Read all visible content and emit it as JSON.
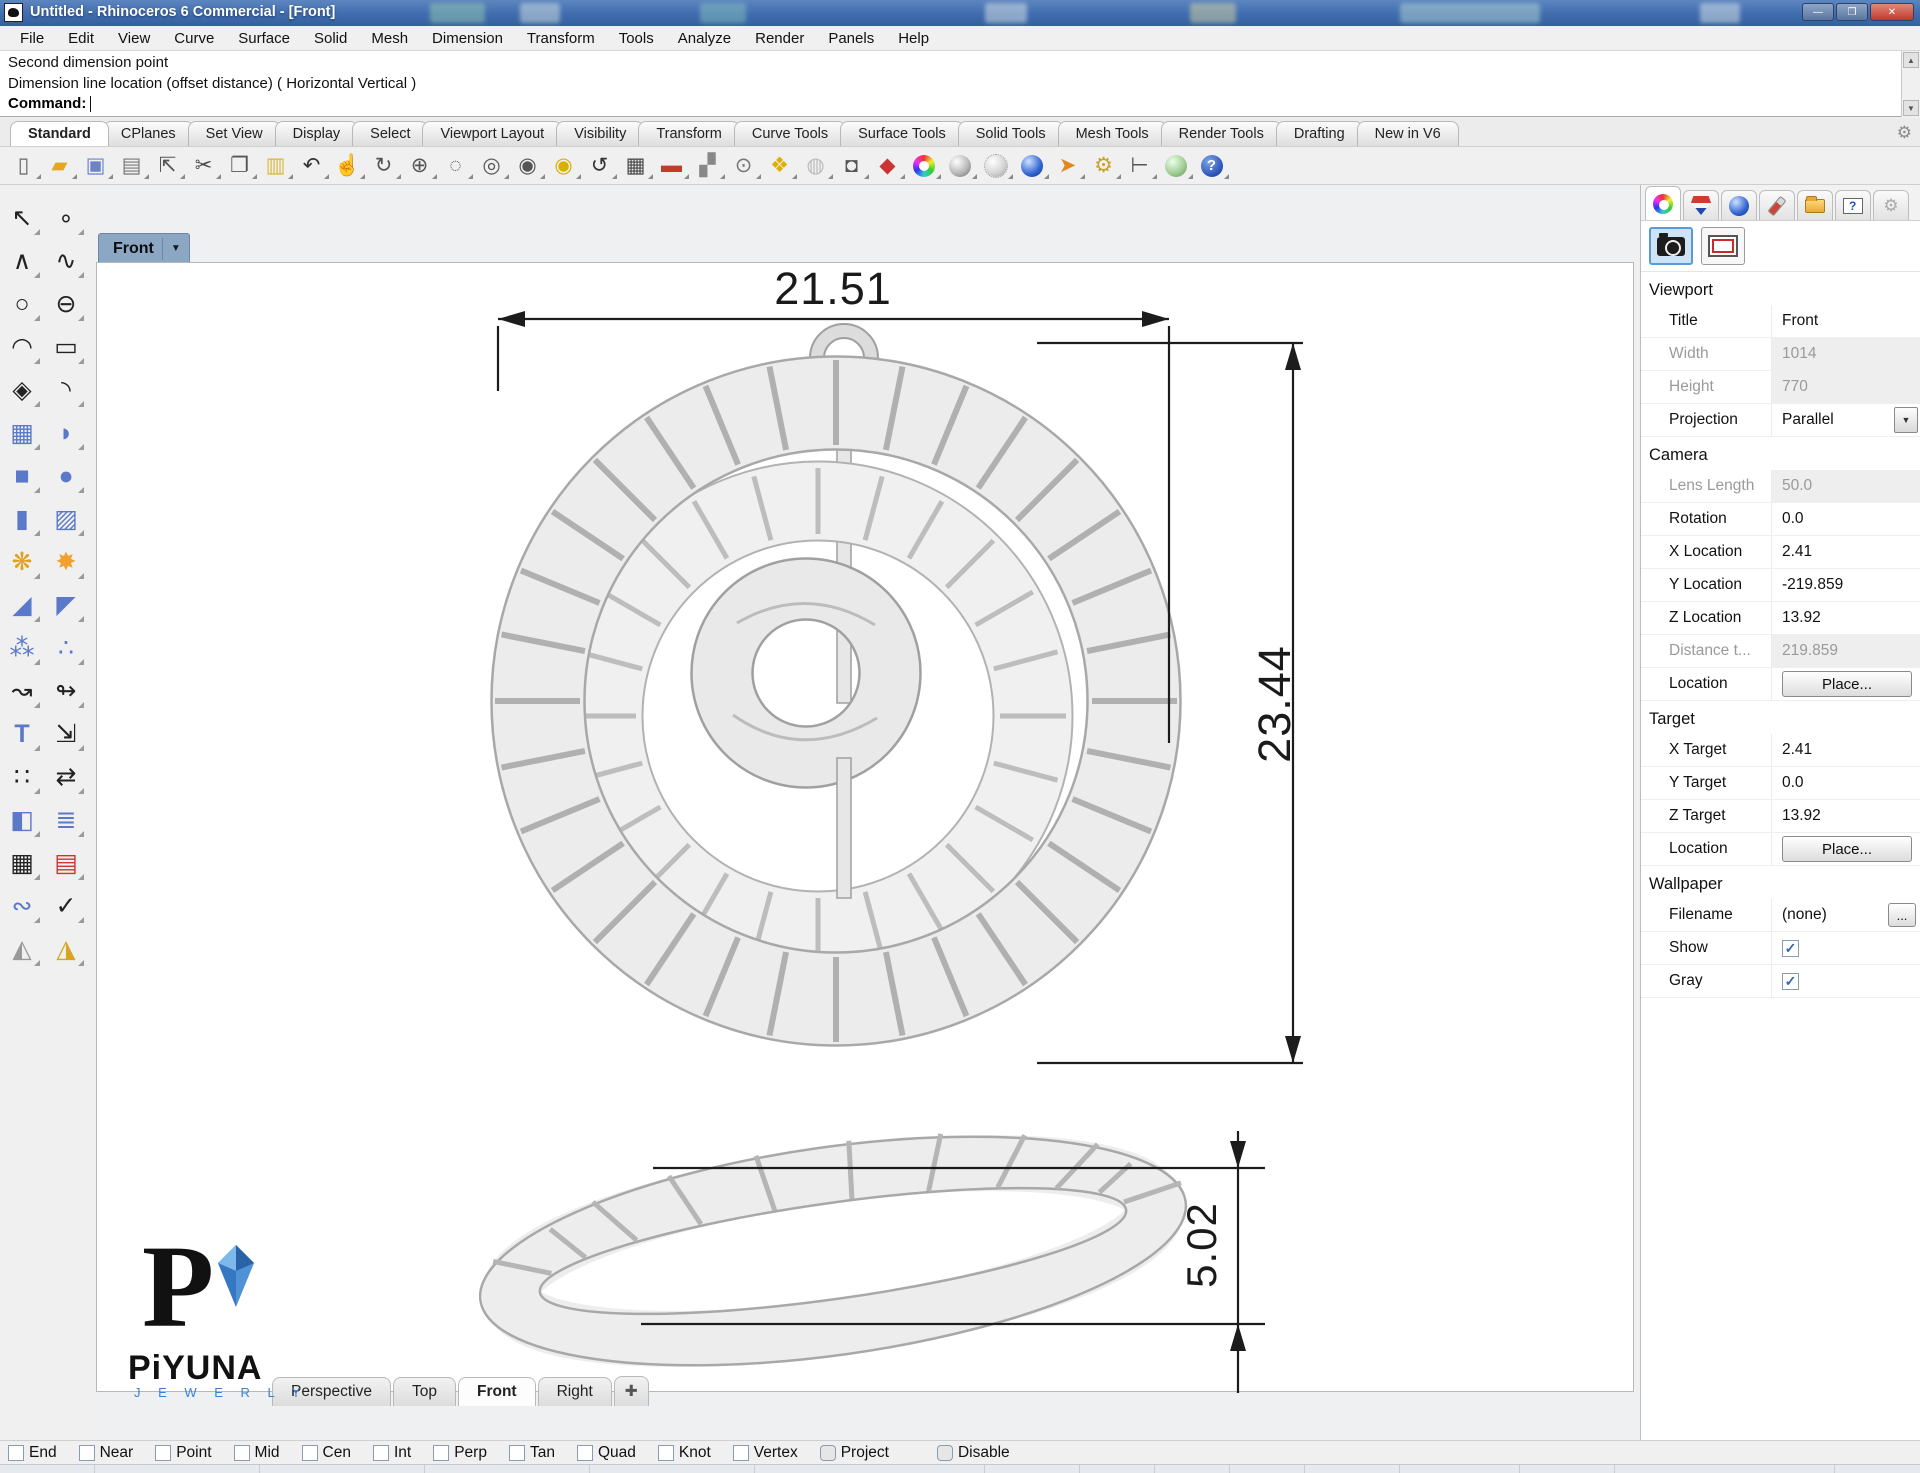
{
  "window": {
    "title": "Untitled - Rhinoceros 6 Commercial - [Front]",
    "buttons": {
      "minimize": "—",
      "restore": "❐",
      "close": "✕"
    }
  },
  "menu": {
    "items": [
      "File",
      "Edit",
      "View",
      "Curve",
      "Surface",
      "Solid",
      "Mesh",
      "Dimension",
      "Transform",
      "Tools",
      "Analyze",
      "Render",
      "Panels",
      "Help"
    ]
  },
  "command": {
    "history_line1": "Second dimension point",
    "history_line2": "Dimension line location (offset distance) ( Horizontal  Vertical )",
    "prompt_label": "Command:"
  },
  "tabstrip": {
    "tabs": [
      "Standard",
      "CPlanes",
      "Set View",
      "Display",
      "Select",
      "Viewport Layout",
      "Visibility",
      "Transform",
      "Curve Tools",
      "Surface Tools",
      "Solid Tools",
      "Mesh Tools",
      "Render Tools",
      "Drafting",
      "New in V6"
    ],
    "active": "Standard",
    "gear_glyph": "⚙"
  },
  "toolbar": {
    "icons": [
      {
        "glyph": "▯",
        "css": "color:#666"
      },
      {
        "glyph": "▰",
        "css": "color:#e3a820"
      },
      {
        "glyph": "▣",
        "css": "color:#6d83c9"
      },
      {
        "glyph": "▤",
        "css": "color:#777"
      },
      {
        "glyph": "⇱",
        "css": "color:#555"
      },
      {
        "glyph": "✂",
        "css": "color:#444"
      },
      {
        "glyph": "❐",
        "css": "color:#555"
      },
      {
        "glyph": "▥",
        "css": "color:#d9b83f"
      },
      {
        "glyph": "↶",
        "css": "color:#333"
      },
      {
        "glyph": "☝",
        "css": "color:#999"
      },
      {
        "glyph": "↻",
        "css": "color:#555"
      },
      {
        "glyph": "⊕",
        "css": "color:#555"
      },
      {
        "glyph": "◌",
        "css": "color:#555"
      },
      {
        "glyph": "◎",
        "css": "color:#555"
      },
      {
        "glyph": "◉",
        "css": "color:#555"
      },
      {
        "glyph": "◉",
        "css": "color:#d9b000"
      },
      {
        "glyph": "↺",
        "css": "color:#333"
      },
      {
        "glyph": "▦",
        "css": "color:#444"
      },
      {
        "glyph": "▬",
        "css": "color:#c23a2a"
      },
      {
        "glyph": "▞",
        "css": "color:#888"
      },
      {
        "glyph": "⊙",
        "css": "color:#777"
      },
      {
        "glyph": "❖",
        "css": "color:#dfae00"
      },
      {
        "glyph": "◍",
        "css": "color:#b9b9b9"
      },
      {
        "glyph": "◘",
        "css": "color:#555"
      },
      {
        "glyph": "◆",
        "css": "color:#cc3333"
      },
      {
        "glyph": "",
        "css": ""
      },
      {
        "glyph": "",
        "css": ""
      },
      {
        "glyph": "",
        "css": ""
      },
      {
        "glyph": "",
        "css": ""
      },
      {
        "glyph": "➤",
        "css": "color:#e2881f"
      },
      {
        "glyph": "⚙",
        "css": "color:#c9a227"
      },
      {
        "glyph": "⊢",
        "css": "color:#555"
      },
      {
        "glyph": "",
        "css": ""
      },
      {
        "glyph": "?",
        "css": ""
      }
    ]
  },
  "sidebar": {
    "icons": [
      {
        "glyph": "↖",
        "css": "color:#222"
      },
      {
        "glyph": "∘",
        "css": "color:#222"
      },
      {
        "glyph": "∧",
        "css": "color:#222"
      },
      {
        "glyph": "∿",
        "css": "color:#222"
      },
      {
        "glyph": "○",
        "css": "color:#222"
      },
      {
        "glyph": "⊖",
        "css": "color:#222"
      },
      {
        "glyph": "◠",
        "css": "color:#222"
      },
      {
        "glyph": "▭",
        "css": "color:#222"
      },
      {
        "glyph": "◈",
        "css": "color:#222"
      },
      {
        "glyph": "◝",
        "css": "color:#222"
      },
      {
        "glyph": "▦",
        "css": "color:#5b79c9"
      },
      {
        "glyph": "◗",
        "css": "color:#5b79c9"
      },
      {
        "glyph": "■",
        "css": "color:#5b79c9"
      },
      {
        "glyph": "●",
        "css": "color:#5b79c9"
      },
      {
        "glyph": "▮",
        "css": "color:#5b79c9"
      },
      {
        "glyph": "▨",
        "css": "color:#5b79c9"
      },
      {
        "glyph": "❋",
        "css": "color:#e0a020"
      },
      {
        "glyph": "✸",
        "css": "color:#f0a030"
      },
      {
        "glyph": "◢",
        "css": "color:#5b79c9"
      },
      {
        "glyph": "◤",
        "css": "color:#5b79c9"
      },
      {
        "glyph": "⁂",
        "css": "color:#5b79c9"
      },
      {
        "glyph": "∴",
        "css": "color:#5b79c9"
      },
      {
        "glyph": "↝",
        "css": "color:#222"
      },
      {
        "glyph": "↬",
        "css": "color:#222"
      },
      {
        "glyph": "T",
        "css": "color:#5b79c9;font-weight:bold"
      },
      {
        "glyph": "⇲",
        "css": "color:#222"
      },
      {
        "glyph": "∷",
        "css": "color:#222"
      },
      {
        "glyph": "⇄",
        "css": "color:#222"
      },
      {
        "glyph": "◧",
        "css": "color:#5b79c9"
      },
      {
        "glyph": "≣",
        "css": "color:#5b79c9"
      },
      {
        "glyph": "▦",
        "css": "color:#222"
      },
      {
        "glyph": "▤",
        "css": "color:#cc3333"
      },
      {
        "glyph": "∾",
        "css": "color:#5b79c9"
      },
      {
        "glyph": "✓",
        "css": "color:#222"
      },
      {
        "glyph": "◭",
        "css": "color:#999"
      },
      {
        "glyph": "◮",
        "css": "color:#d9a520"
      }
    ]
  },
  "viewport": {
    "tab_label": "Front",
    "tab_arrow": "▼",
    "dim_width": "21.51",
    "dim_height": "23.44",
    "dim_thickness": "5.02"
  },
  "logo": {
    "mark": "P",
    "brand": "PiYUNA",
    "sub": "J E W E R L Y"
  },
  "bottom_tabs": {
    "tabs": [
      "Perspective",
      "Top",
      "Front",
      "Right"
    ],
    "active": "Front",
    "add_label": "✚"
  },
  "panel": {
    "viewport": {
      "title": "Viewport",
      "rows": [
        {
          "label": "Title",
          "value": "Front"
        },
        {
          "label": "Width",
          "value": "1014"
        },
        {
          "label": "Height",
          "value": "770"
        },
        {
          "label": "Projection",
          "value": "Parallel"
        }
      ],
      "dropdown_arrow": "▼"
    },
    "camera": {
      "title": "Camera",
      "rows": [
        {
          "label": "Lens Length",
          "value": "50.0"
        },
        {
          "label": "Rotation",
          "value": "0.0"
        },
        {
          "label": "X Location",
          "value": "2.41"
        },
        {
          "label": "Y Location",
          "value": "-219.859"
        },
        {
          "label": "Z Location",
          "value": "13.92"
        },
        {
          "label": "Distance t...",
          "value": "219.859"
        },
        {
          "label": "Location",
          "value": "Place..."
        }
      ]
    },
    "target": {
      "title": "Target",
      "rows": [
        {
          "label": "X Target",
          "value": "2.41"
        },
        {
          "label": "Y Target",
          "value": "0.0"
        },
        {
          "label": "Z Target",
          "value": "13.92"
        },
        {
          "label": "Location",
          "value": "Place..."
        }
      ]
    },
    "wallpaper": {
      "title": "Wallpaper",
      "rows": [
        {
          "label": "Filename",
          "value": "(none)",
          "more": "..."
        },
        {
          "label": "Show"
        },
        {
          "label": "Gray"
        }
      ]
    }
  },
  "osnap": {
    "items": [
      "End",
      "Near",
      "Point",
      "Mid",
      "Cen",
      "Int",
      "Perp",
      "Tan",
      "Quad",
      "Knot",
      "Vertex",
      "Project",
      "Disable"
    ]
  }
}
